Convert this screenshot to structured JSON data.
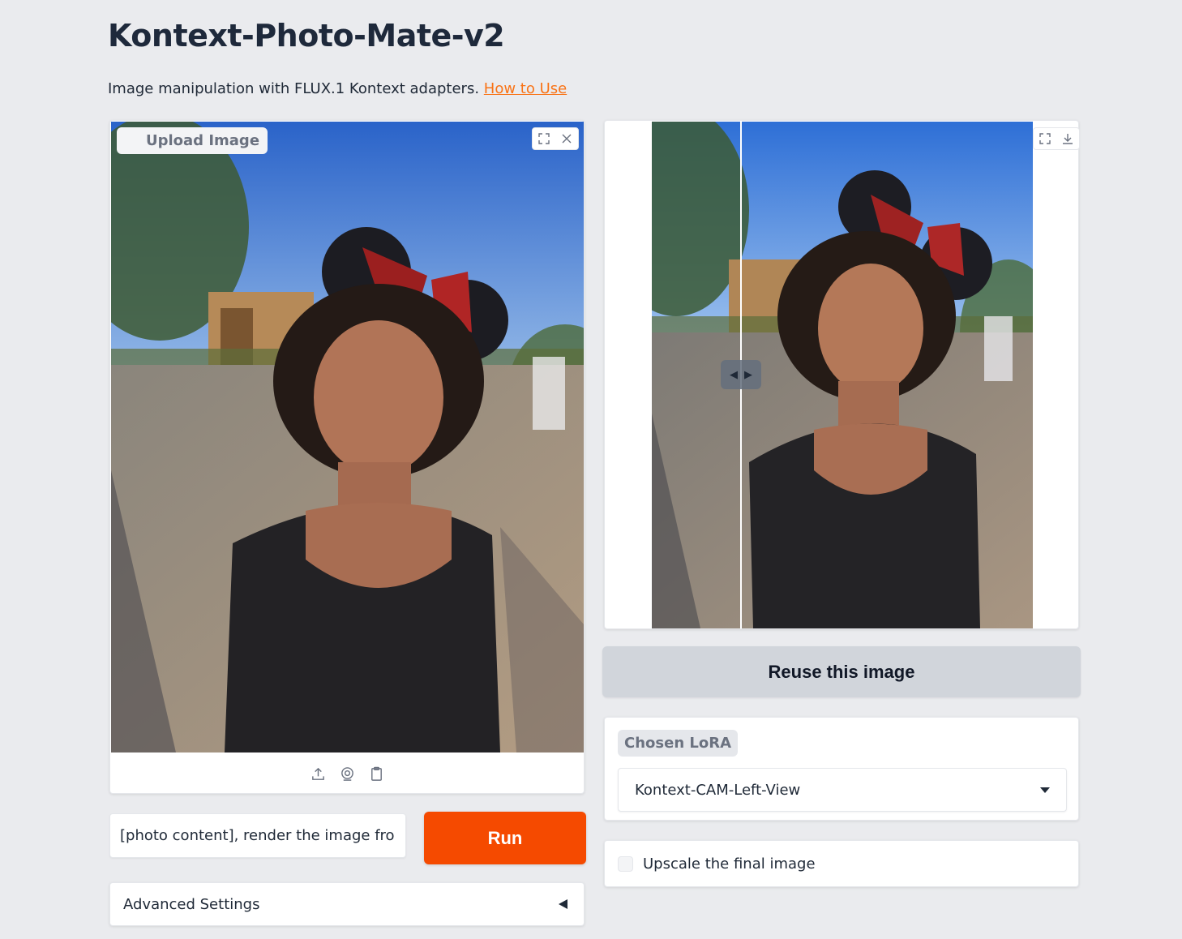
{
  "app": {
    "title": "Kontext-Photo-Mate-v2",
    "description": "Image manipulation with FLUX.1 Kontext adapters.",
    "how_to_link": "How to Use"
  },
  "input_image": {
    "label": "Upload Image",
    "toolbar_icons": [
      "fullscreen-icon",
      "close-icon"
    ],
    "source_icons": [
      "upload-icon",
      "webcam-icon",
      "clipboard-icon"
    ]
  },
  "output_image": {
    "toolbar_icons": [
      "fullscreen-icon",
      "download-icon"
    ],
    "comparison_slider_position": 0.23
  },
  "reuse_button": "Reuse this image",
  "lora": {
    "label": "Chosen LoRA",
    "selected": "Kontext-CAM-Left-View"
  },
  "upscale": {
    "label": "Upscale the final image",
    "checked": false
  },
  "prompt": {
    "value": "[photo content], render the image fron"
  },
  "run_button": "Run",
  "advanced": {
    "label": "Advanced Settings"
  },
  "colors": {
    "accent": "#f54a00",
    "link": "#f97316",
    "background": "#eaebee"
  }
}
